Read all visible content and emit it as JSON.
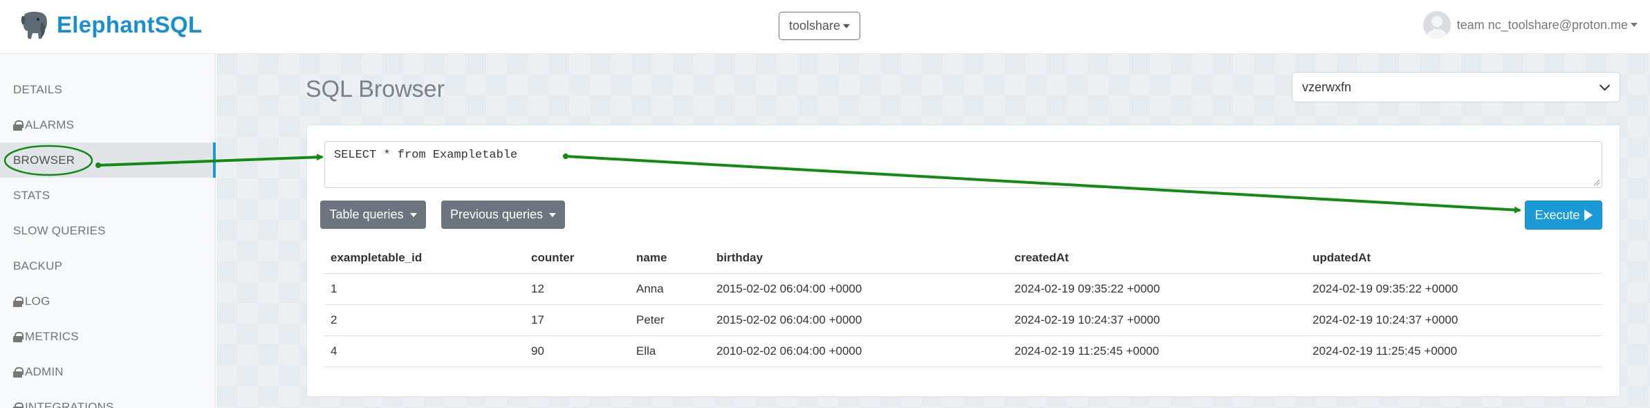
{
  "brand": {
    "name": "ElephantSQL"
  },
  "header": {
    "team_selector": "toolshare",
    "user_label": "team nc_toolshare@proton.me"
  },
  "sidebar": {
    "items": [
      {
        "label": "DETAILS",
        "locked": false
      },
      {
        "label": "ALARMS",
        "locked": true
      },
      {
        "label": "BROWSER",
        "locked": false,
        "active": true
      },
      {
        "label": "STATS",
        "locked": false
      },
      {
        "label": "SLOW QUERIES",
        "locked": false
      },
      {
        "label": "BACKUP",
        "locked": false
      },
      {
        "label": "LOG",
        "locked": true
      },
      {
        "label": "METRICS",
        "locked": true
      },
      {
        "label": "ADMIN",
        "locked": true
      },
      {
        "label": "INTEGRATIONS",
        "locked": true
      }
    ]
  },
  "main": {
    "title": "SQL Browser",
    "database_select": "vzerwxfn",
    "query": "SELECT * from Exampletable",
    "buttons": {
      "table_queries": "Table queries",
      "previous_queries": "Previous queries",
      "execute": "Execute"
    },
    "results": {
      "columns": [
        "exampletable_id",
        "counter",
        "name",
        "birthday",
        "createdAt",
        "updatedAt"
      ],
      "rows": [
        [
          "1",
          "12",
          "Anna",
          "2015-02-02 06:04:00 +0000",
          "2024-02-19 09:35:22 +0000",
          "2024-02-19 09:35:22 +0000"
        ],
        [
          "2",
          "17",
          "Peter",
          "2015-02-02 06:04:00 +0000",
          "2024-02-19 10:24:37 +0000",
          "2024-02-19 10:24:37 +0000"
        ],
        [
          "4",
          "90",
          "Ella",
          "2010-02-02 06:04:00 +0000",
          "2024-02-19 11:25:45 +0000",
          "2024-02-19 11:25:45 +0000"
        ]
      ]
    }
  },
  "colors": {
    "brand": "#1a8fd0",
    "accent": "#1a9ad6",
    "secondary_button": "#6c757d",
    "annotation": "#138a13"
  }
}
